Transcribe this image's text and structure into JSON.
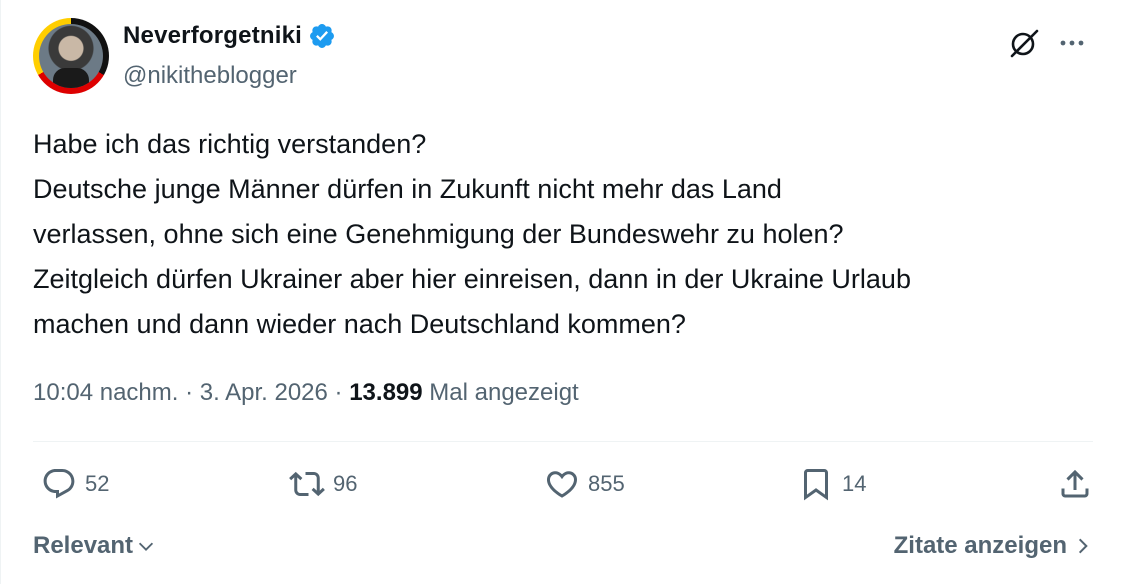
{
  "author": {
    "display_name": "Neverforgetniki",
    "handle": "@nikitheblogger"
  },
  "tweet": {
    "text": "Habe ich das richtig verstanden?\nDeutsche junge Männer dürfen in Zukunft nicht mehr das Land\nverlassen, ohne sich eine Genehmigung der Bundeswehr zu holen?\nZeitgleich dürfen Ukrainer aber hier einreisen, dann in der Ukraine Urlaub\nmachen und dann wieder nach Deutschland kommen?",
    "time": "10:04 nachm.",
    "sep1": " · ",
    "date": "3. Apr. 2026",
    "sep2": " · ",
    "views_count": "13.899",
    "views_label": " Mal angezeigt"
  },
  "actions": {
    "replies": "52",
    "reposts": "96",
    "likes": "855",
    "bookmarks": "14"
  },
  "footer": {
    "sort_label": "Relevant",
    "quotes_label": "Zitate anzeigen"
  },
  "colors": {
    "verified": "#1d9bf0",
    "muted": "#536471",
    "text": "#0f1419"
  },
  "icons": [
    "verified-badge-icon",
    "grok-icon",
    "more-icon",
    "reply-icon",
    "repost-icon",
    "like-icon",
    "bookmark-icon",
    "share-icon",
    "chevron-down-icon",
    "chevron-right-icon"
  ]
}
